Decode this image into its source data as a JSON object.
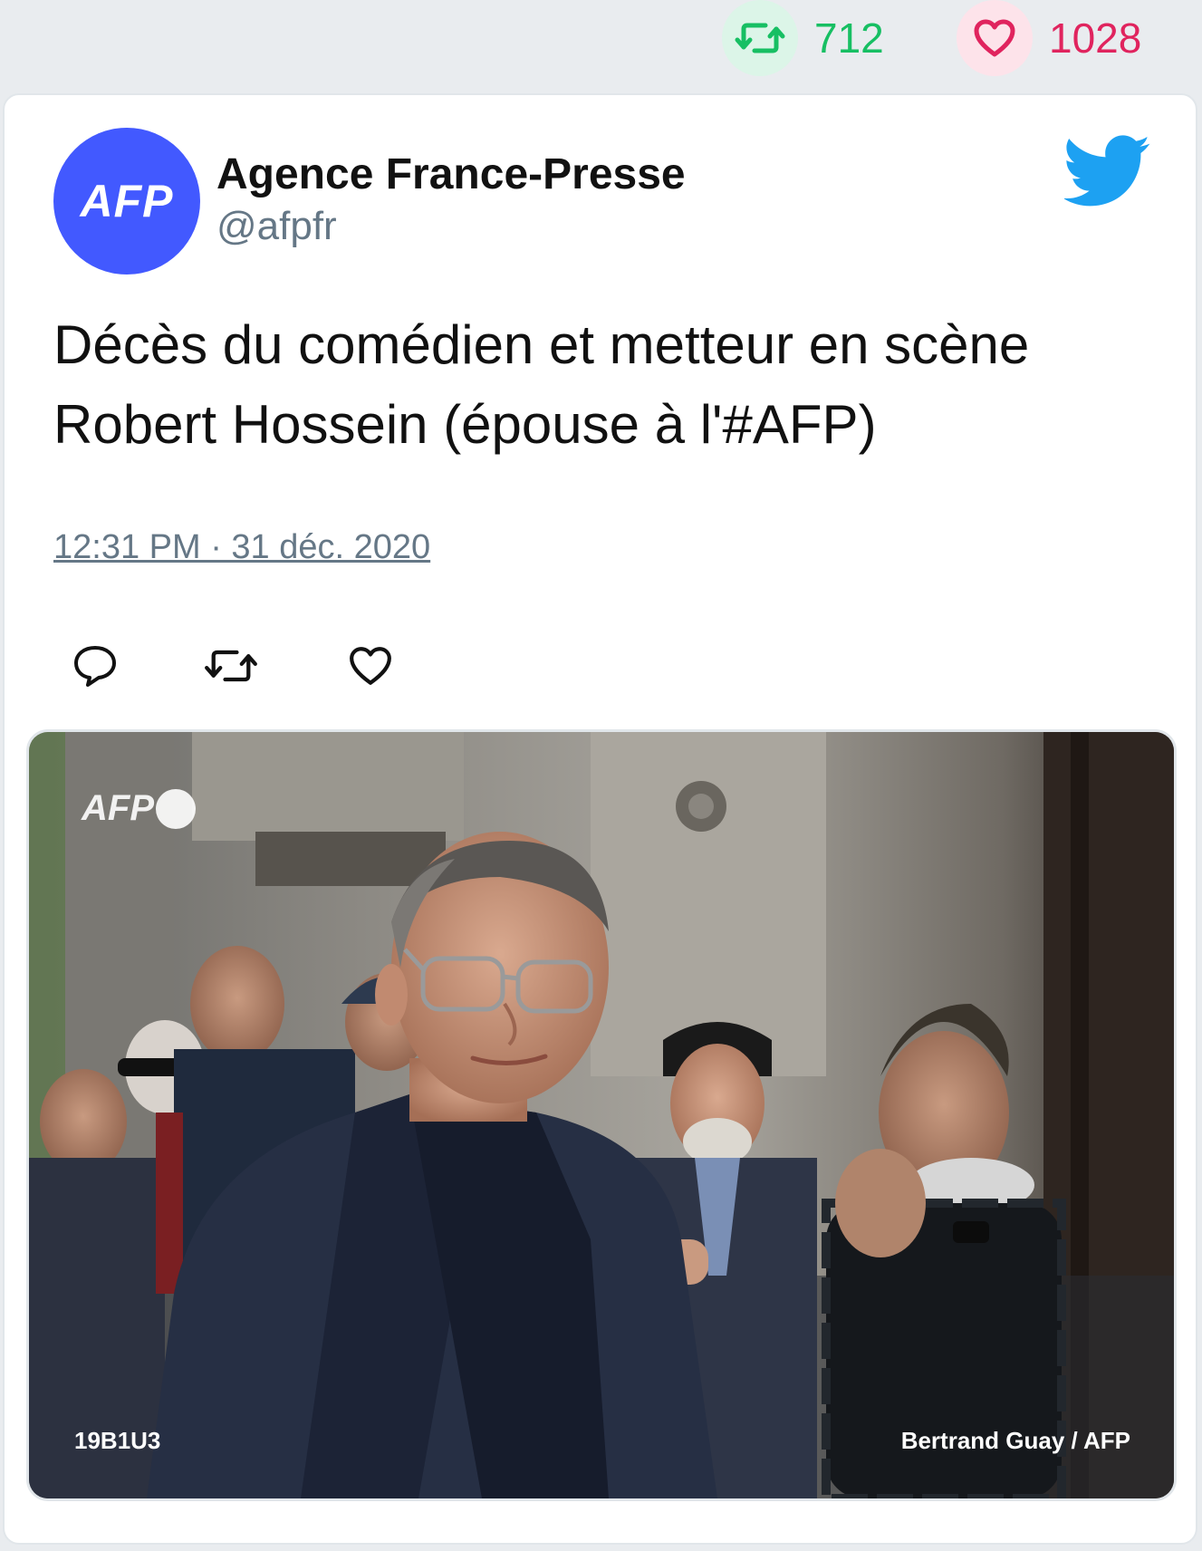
{
  "stats": {
    "retweets": "712",
    "likes": "1028"
  },
  "author": {
    "avatar_text": "AFP",
    "name": "Agence France-Presse",
    "handle": "@afpfr"
  },
  "tweet": {
    "text": "Décès du comédien et metteur en scène Robert Hossein (épouse à l'#AFP)",
    "timestamp": "12:31 PM · 31 déc. 2020"
  },
  "actions": {
    "reply_icon": "reply-icon",
    "retweet_icon": "retweet-icon",
    "like_icon": "heart-icon"
  },
  "media": {
    "logo_text": "AFP",
    "photo_id": "19B1U3",
    "credit": "Bertrand Guay / AFP"
  },
  "colors": {
    "retweet_green": "#17bf63",
    "like_red": "#e0245e",
    "twitter_blue": "#1da1f2",
    "afp_blue": "#4259ff",
    "muted_gray": "#657786"
  }
}
